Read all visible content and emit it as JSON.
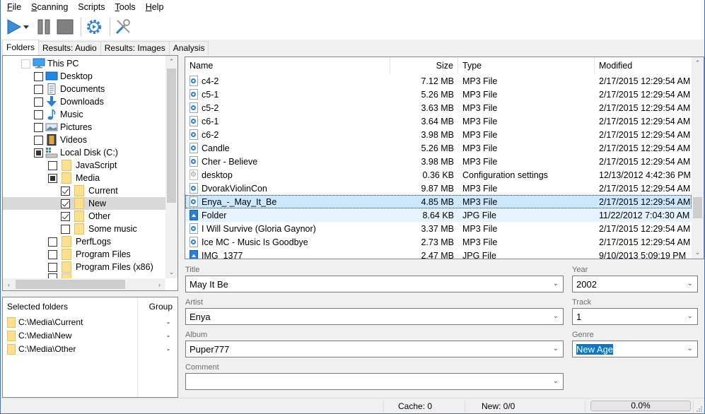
{
  "menu": [
    {
      "label": "File",
      "accel": "F",
      "rest": "ile"
    },
    {
      "label": "Scanning",
      "accel": "S",
      "rest": "canning"
    },
    {
      "label": "Scripts",
      "accel": "",
      "rest": "Scripts"
    },
    {
      "label": "Tools",
      "accel": "T",
      "rest": "ools"
    },
    {
      "label": "Help",
      "accel": "H",
      "rest": "elp"
    }
  ],
  "toolbar": {
    "icons": [
      "play-icon",
      "dropdown-arrow-icon",
      "pause-icon",
      "stop-icon",
      "settings-gear-icon",
      "tools-icon"
    ],
    "accent": "#2a7fd4"
  },
  "tabs": [
    {
      "label": "Folders",
      "active": true
    },
    {
      "label": "Results: Audio",
      "active": false
    },
    {
      "label": "Results: Images",
      "active": false
    },
    {
      "label": "Analysis",
      "active": false
    }
  ],
  "tree": {
    "items": [
      {
        "label": "This PC",
        "state": "none",
        "icon": "computer-icon",
        "level": 0
      },
      {
        "label": "Desktop",
        "state": "unchecked",
        "icon": "desktop-icon",
        "level": 1
      },
      {
        "label": "Documents",
        "state": "unchecked",
        "icon": "documents-icon",
        "level": 1
      },
      {
        "label": "Downloads",
        "state": "unchecked",
        "icon": "downloads-icon",
        "level": 1
      },
      {
        "label": "Music",
        "state": "unchecked",
        "icon": "music-icon",
        "level": 1
      },
      {
        "label": "Pictures",
        "state": "unchecked",
        "icon": "pictures-icon",
        "level": 1
      },
      {
        "label": "Videos",
        "state": "unchecked",
        "icon": "videos-icon",
        "level": 1
      },
      {
        "label": "Local Disk (C:)",
        "state": "partial",
        "icon": "drive-icon",
        "level": 1
      },
      {
        "label": "JavaScript",
        "state": "unchecked",
        "icon": "folder-icon",
        "level": 2
      },
      {
        "label": "Media",
        "state": "partial",
        "icon": "folder-icon",
        "level": 2
      },
      {
        "label": "Current",
        "state": "checked",
        "icon": "folder-icon",
        "level": 3
      },
      {
        "label": "New",
        "state": "checked",
        "icon": "folder-icon",
        "level": 3,
        "selected": true
      },
      {
        "label": "Other",
        "state": "checked",
        "icon": "folder-icon",
        "level": 3
      },
      {
        "label": "Some music",
        "state": "unchecked",
        "icon": "folder-icon",
        "level": 3
      },
      {
        "label": "PerfLogs",
        "state": "unchecked",
        "icon": "folder-icon",
        "level": 2
      },
      {
        "label": "Program Files",
        "state": "unchecked",
        "icon": "folder-icon",
        "level": 2
      },
      {
        "label": "Program Files (x86)",
        "state": "unchecked",
        "icon": "folder-icon",
        "level": 2
      }
    ]
  },
  "selected_folders": {
    "header": "Selected folders",
    "group_header": "Group",
    "items": [
      {
        "path": "C:\\Media\\Current",
        "group": "-"
      },
      {
        "path": "C:\\Media\\New",
        "group": "-"
      },
      {
        "path": "C:\\Media\\Other",
        "group": "-"
      }
    ]
  },
  "filelist": {
    "columns": [
      "Name",
      "Size",
      "Type",
      "Modified"
    ],
    "rows": [
      {
        "name": "c4-2",
        "size": "7.12 MB",
        "type": "MP3 File",
        "modified": "2/17/2015 12:29:54 AM",
        "kind": "mp3"
      },
      {
        "name": "c5-1",
        "size": "5.26 MB",
        "type": "MP3 File",
        "modified": "2/17/2015 12:29:54 AM",
        "kind": "mp3"
      },
      {
        "name": "c5-2",
        "size": "3.63 MB",
        "type": "MP3 File",
        "modified": "2/17/2015 12:29:54 AM",
        "kind": "mp3"
      },
      {
        "name": "c6-1",
        "size": "3.64 MB",
        "type": "MP3 File",
        "modified": "2/17/2015 12:29:54 AM",
        "kind": "mp3"
      },
      {
        "name": "c6-2",
        "size": "3.98 MB",
        "type": "MP3 File",
        "modified": "2/17/2015 12:29:54 AM",
        "kind": "mp3"
      },
      {
        "name": "Candle",
        "size": "5.26 MB",
        "type": "MP3 File",
        "modified": "2/17/2015 12:29:54 AM",
        "kind": "mp3"
      },
      {
        "name": "Cher - Believe",
        "size": "3.98 MB",
        "type": "MP3 File",
        "modified": "2/17/2015 12:29:54 AM",
        "kind": "mp3"
      },
      {
        "name": "desktop",
        "size": "0.36 KB",
        "type": "Configuration settings",
        "modified": "12/13/2012 4:42:36 PM",
        "kind": "cfg"
      },
      {
        "name": "DvorakViolinCon",
        "size": "9.87 MB",
        "type": "MP3 File",
        "modified": "2/17/2015 12:29:54 AM",
        "kind": "mp3"
      },
      {
        "name": "Enya_-_May_It_Be",
        "size": "4.85 MB",
        "type": "MP3 File",
        "modified": "2/17/2015 12:29:54 AM",
        "kind": "mp3",
        "selected": true
      },
      {
        "name": "Folder",
        "size": "8.64 KB",
        "type": "JPG File",
        "modified": "11/22/2012 7:04:30 AM",
        "kind": "jpg",
        "hover": true
      },
      {
        "name": "I Will Survive (Gloria Gaynor)",
        "size": "3.37 MB",
        "type": "MP3 File",
        "modified": "2/17/2015 12:29:54 AM",
        "kind": "mp3"
      },
      {
        "name": "Ice MC - Music Is Goodbye",
        "size": "2.73 MB",
        "type": "MP3 File",
        "modified": "2/17/2015 12:29:54 AM",
        "kind": "mp3"
      },
      {
        "name": "IMG_1377",
        "size": "2.47 MB",
        "type": "JPG File",
        "modified": "9/10/2013 5:09:19 PM",
        "kind": "jpg"
      }
    ]
  },
  "form": {
    "title": {
      "label": "Title",
      "value": "May It Be"
    },
    "year": {
      "label": "Year",
      "value": "2002"
    },
    "artist": {
      "label": "Artist",
      "value": "Enya"
    },
    "track": {
      "label": "Track",
      "value": "1"
    },
    "album": {
      "label": "Album",
      "value": "Puper777"
    },
    "genre": {
      "label": "Genre",
      "value": "New Age"
    },
    "comment": {
      "label": "Comment",
      "value": ""
    }
  },
  "status": {
    "cache": "Cache: 0",
    "new": "New: 0/0",
    "progress_text": "0.0%",
    "progress_fraction": 0.0
  }
}
